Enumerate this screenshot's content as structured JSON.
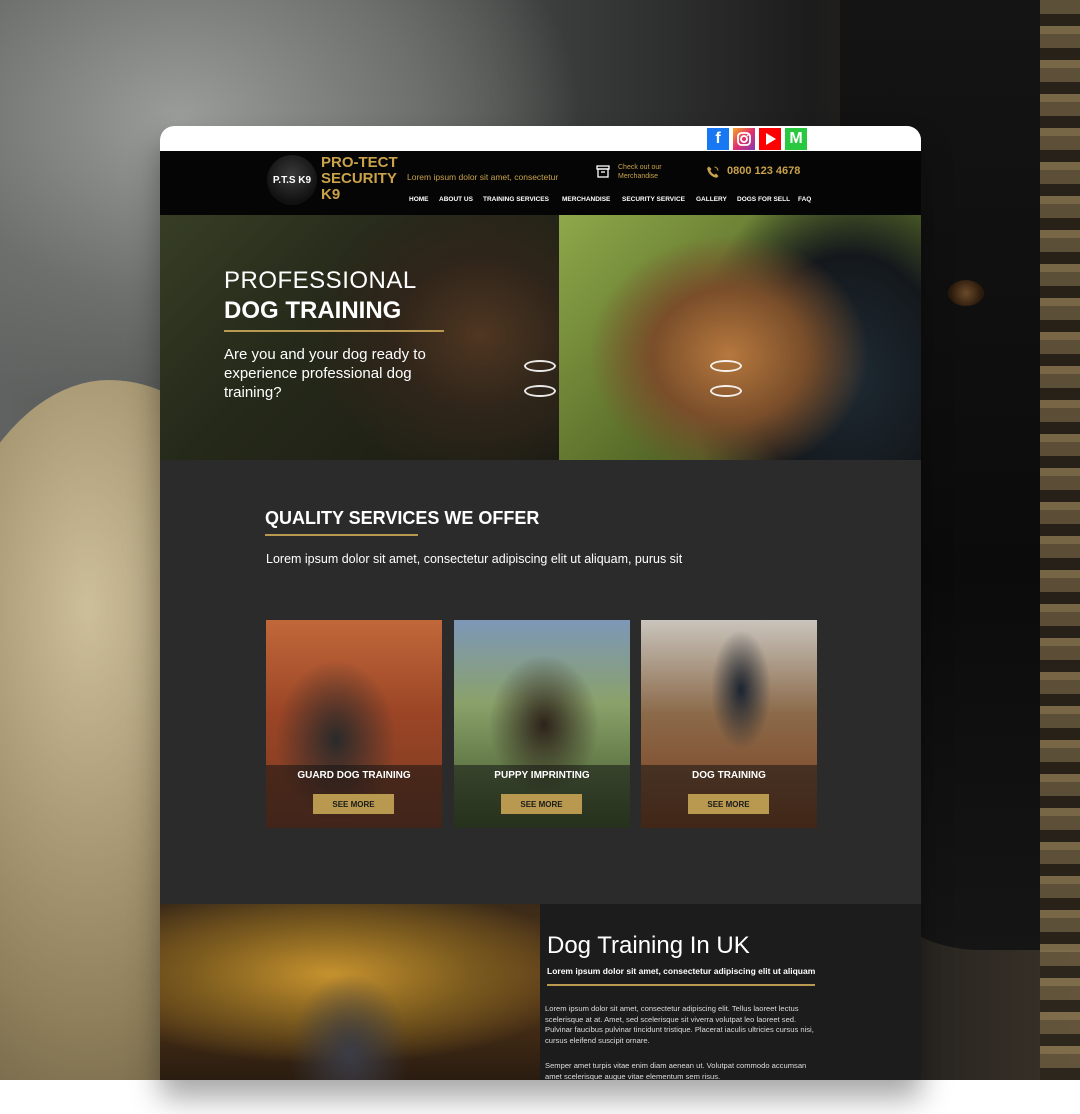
{
  "social": {
    "facebook": "f",
    "instagram": "instagram",
    "youtube": "youtube",
    "gmail": "M"
  },
  "header": {
    "logo_text": "P.T.S K9",
    "brand_lines": [
      "PRO-TECT",
      "SECURITY",
      "K9"
    ],
    "tagline": "Lorem ipsum dolor sit amet, consectetur",
    "merch_text": "Check out our Merchandise",
    "phone": "0800 123 4678"
  },
  "nav": {
    "items": [
      "HOME",
      "ABOUT US",
      "TRAINING SERVICES",
      "MERCHANDISE",
      "SECURITY SERVICE",
      "GALLERY",
      "DOGS FOR SELL",
      "FAQ"
    ]
  },
  "hero": {
    "title_line1": "PROFESSIONAL",
    "title_line2": "DOG TRAINING",
    "subtitle": "Are you and your dog ready to experience professional dog training?"
  },
  "services": {
    "title": "QUALITY SERVICES WE OFFER",
    "subtitle": "Lorem ipsum dolor sit amet, consectetur adipiscing elit ut aliquam, purus sit",
    "cards": [
      {
        "label": "GUARD DOG TRAINING",
        "button": "SEE MORE"
      },
      {
        "label": "PUPPY IMPRINTING",
        "button": "SEE MORE"
      },
      {
        "label": "DOG TRAINING",
        "button": "SEE MORE"
      }
    ]
  },
  "about": {
    "title": "Dog Training In UK",
    "subtitle": "Lorem ipsum dolor sit amet, consectetur adipiscing elit ut aliquam",
    "paragraph1": "Lorem ipsum dolor sit amet, consectetur adipiscing elit. Tellus laoreet lectus scelerisque at at. Amet, sed scelerisque sit viverra volutpat leo laoreet sed. Pulvinar faucibus pulvinar tincidunt tristique. Placerat iaculis ultricies cursus nisi, cursus eleifend suscipit ornare.",
    "paragraph2": "Semper amet turpis vitae enim diam aenean ut. Volutpat commodo accumsan amet scelerisque augue vitae elementum sem risus."
  },
  "colors": {
    "accent_gold": "#b8994f",
    "brand_gold": "#c9a24a",
    "dark_bg": "#2b2b2b"
  },
  "icons": [
    "facebook-icon",
    "instagram-icon",
    "youtube-icon",
    "gmail-icon",
    "box-icon",
    "phone-icon",
    "slider-arrow-icon"
  ]
}
